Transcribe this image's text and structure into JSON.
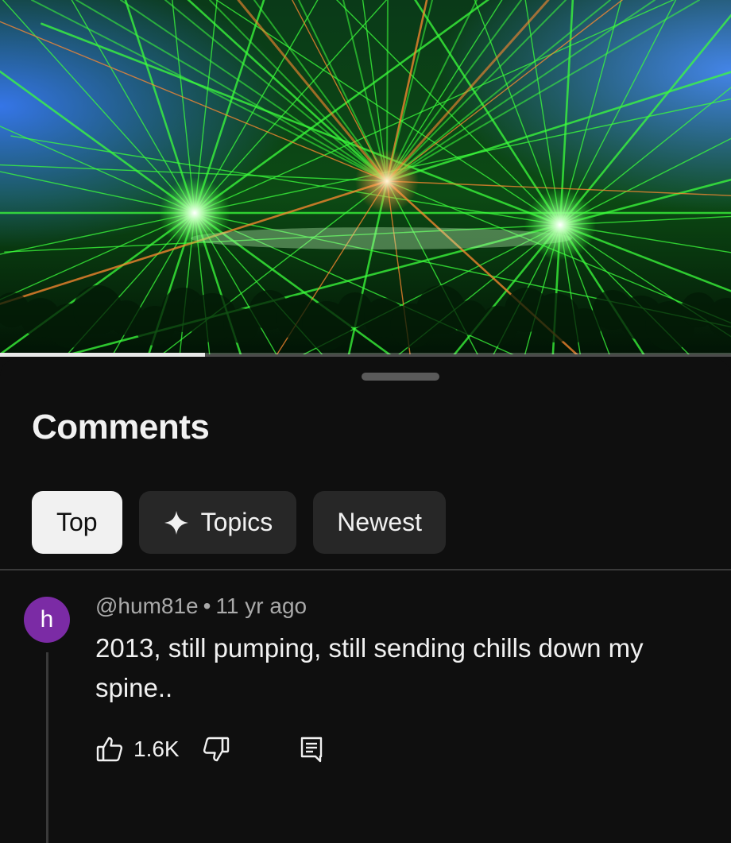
{
  "video": {
    "progress_fraction": 0.28,
    "colors": {
      "laser_green": "#3cff3c",
      "laser_blue": "#3a7bff",
      "laser_orange": "#ff8a30",
      "background": "#02180a"
    }
  },
  "comments_panel": {
    "title": "Comments",
    "chips": [
      {
        "label": "Top",
        "active": true
      },
      {
        "label": "Topics",
        "icon": "sparkle-icon",
        "active": false
      },
      {
        "label": "Newest",
        "active": false
      }
    ]
  },
  "comment": {
    "avatar_letter": "h",
    "avatar_color": "#7b2ba5",
    "author": "@hum81e",
    "separator": "•",
    "time": "11 yr ago",
    "text": "2013, still pumping, still sending chills down my spine..",
    "like_count": "1.6K",
    "icons": {
      "like": "thumbs-up-icon",
      "dislike": "thumbs-down-icon",
      "reply": "reply-icon"
    }
  },
  "theme": {
    "background": "#0f0f0f",
    "chip_bg": "#272727",
    "chip_active_bg": "#f1f1f1",
    "text_primary": "#f1f1f1",
    "text_secondary": "#aaaaaa"
  }
}
